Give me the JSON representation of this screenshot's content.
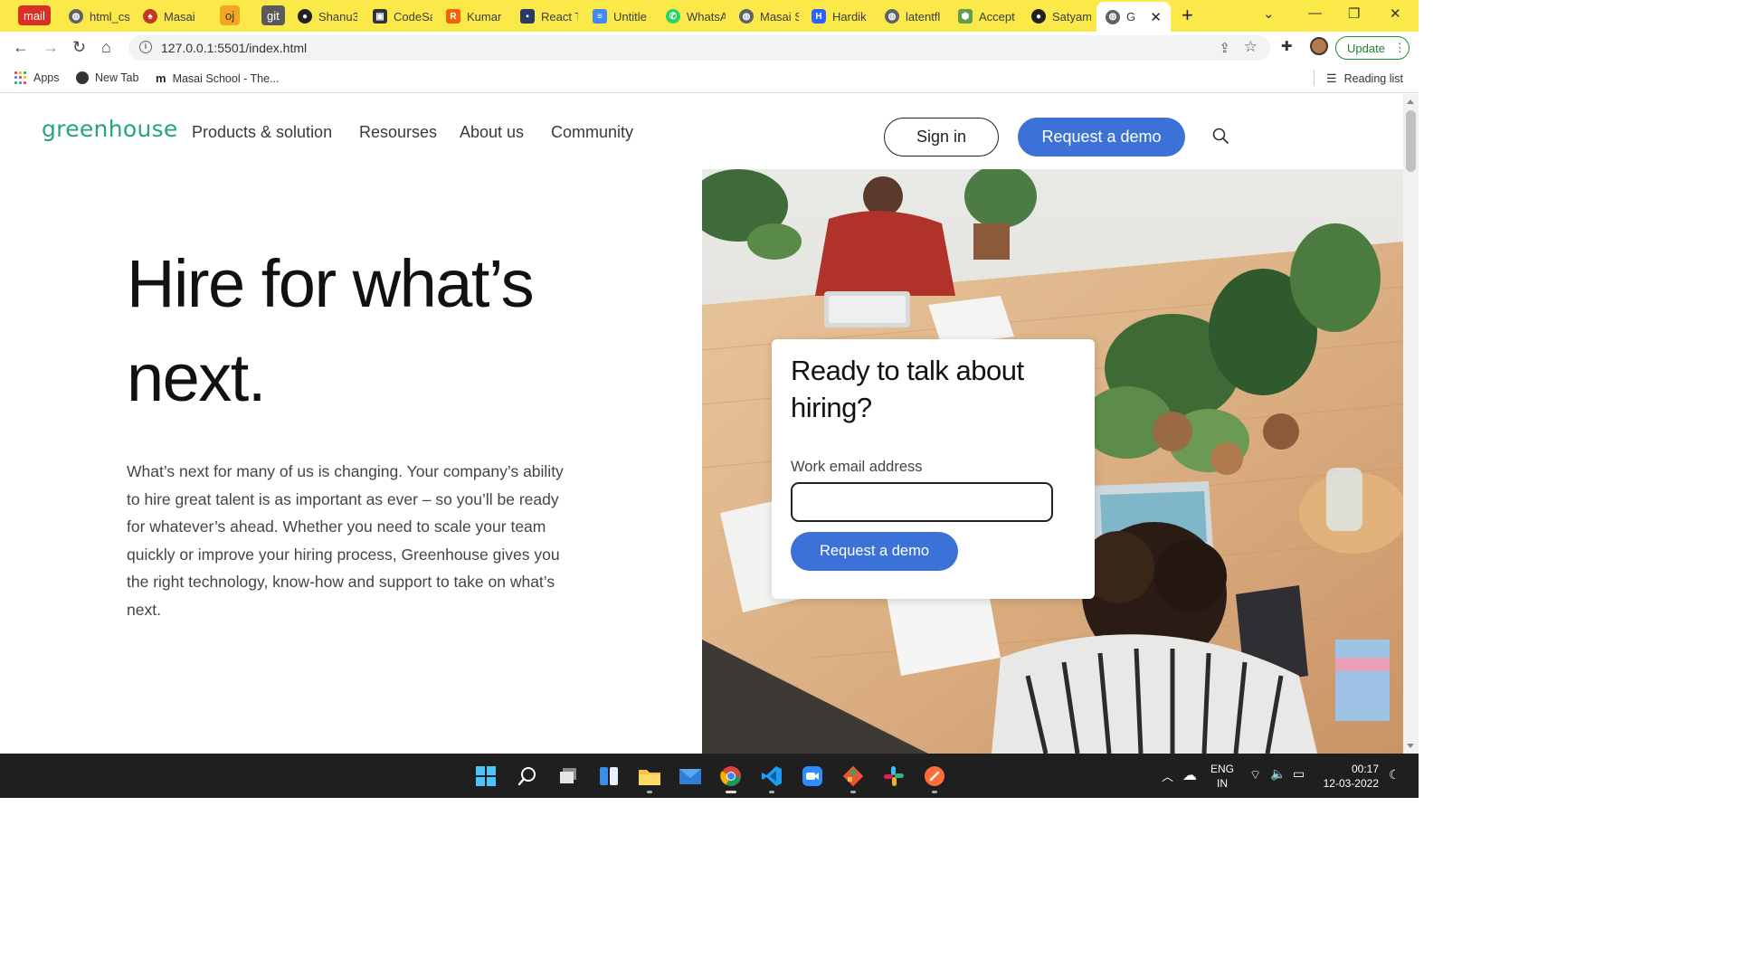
{
  "browser": {
    "tabs": [
      {
        "label": "mail",
        "kind": "badge",
        "color": "#d93025"
      },
      {
        "label": "html_cs",
        "icon": "globe-icon"
      },
      {
        "label": "Masai |",
        "icon": "masai-icon"
      },
      {
        "label": "oj",
        "kind": "badge",
        "color": "#f4a621"
      },
      {
        "label": "git",
        "kind": "badge",
        "color": "#555555"
      },
      {
        "label": "Shanu3",
        "icon": "github-icon"
      },
      {
        "label": "CodeSa",
        "icon": "codesandbox-icon"
      },
      {
        "label": "Kumar",
        "icon": "replit-icon"
      },
      {
        "label": "React T",
        "icon": "floppy-icon"
      },
      {
        "label": "Untitle",
        "icon": "docs-icon"
      },
      {
        "label": "WhatsA",
        "icon": "whatsapp-icon"
      },
      {
        "label": "Masai S",
        "icon": "globe-icon"
      },
      {
        "label": "Hardik",
        "icon": "hashnode-icon"
      },
      {
        "label": "latentfl",
        "icon": "globe-icon"
      },
      {
        "label": "Accept",
        "icon": "node-icon"
      },
      {
        "label": "Satyam",
        "icon": "github-icon"
      },
      {
        "label": "GRE",
        "icon": "globe-icon",
        "active": true
      }
    ],
    "new_tab_symbol": "+",
    "url": "127.0.0.1:5501/index.html",
    "update_label": "Update",
    "bookmarks": [
      {
        "label": "Apps",
        "icon": "apps-grid-icon"
      },
      {
        "label": "New Tab",
        "icon": "globe-icon"
      },
      {
        "label": "Masai School - The...",
        "icon": "masai-m-icon"
      }
    ],
    "reading_list_label": "Reading list"
  },
  "site": {
    "logo_text": "greenhouse",
    "brand_color": "#24a47f",
    "accent_color": "#3c72d8",
    "nav": [
      "Products & solution",
      "Resourses",
      "About us",
      "Community"
    ],
    "signin_label": "Sign in",
    "request_demo_label": "Request a demo"
  },
  "hero": {
    "title": "Hire for what’s next.",
    "paragraph": "What’s next for many of us is changing. Your company’s ability to hire great talent is as important as ever – so you’ll be ready for whatever’s ahead. Whether you need to scale your team quickly or improve your hiring process, Greenhouse gives you the right technology, know-how and support to take on what’s next."
  },
  "form_card": {
    "title": "Ready to talk about hiring?",
    "email_label": "Work email address",
    "email_value": "",
    "email_placeholder": "",
    "submit_label": "Request a demo"
  },
  "taskbar": {
    "apps": [
      "windows-start-icon",
      "search-icon",
      "task-view-icon",
      "widgets-icon",
      "file-explorer-icon",
      "mail-icon",
      "chrome-icon",
      "vscode-icon",
      "zoom-icon",
      "git-icon",
      "slack-icon",
      "postman-icon"
    ],
    "language_line1": "ENG",
    "language_line2": "IN",
    "time": "00:17",
    "date": "12-03-2022"
  }
}
